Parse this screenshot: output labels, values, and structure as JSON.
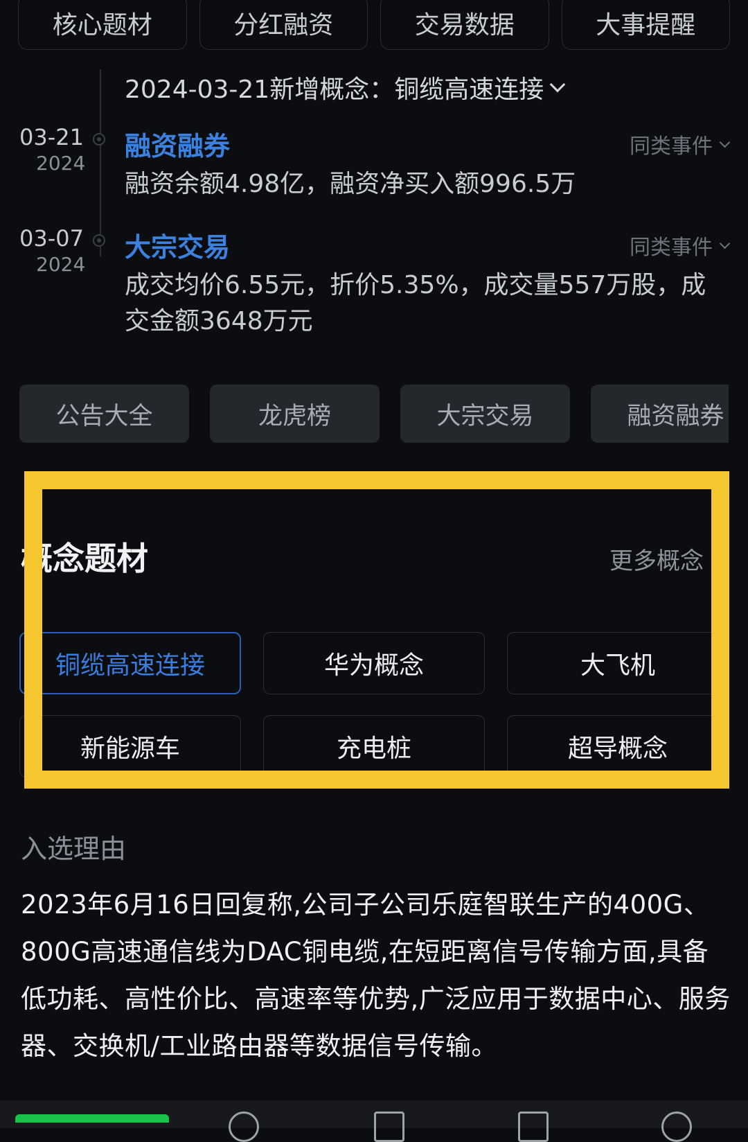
{
  "top_tabs": [
    "核心题材",
    "分红融资",
    "交易数据",
    "大事提醒"
  ],
  "timeline": {
    "new_concept": "2024-03-21新增概念：铜缆高速连接",
    "events": [
      {
        "date": "03-21",
        "year": "2024",
        "title": "融资融券",
        "similar": "同类事件",
        "desc": "融资余额4.98亿，融资净买入额996.5万"
      },
      {
        "date": "03-07",
        "year": "2024",
        "title": "大宗交易",
        "similar": "同类事件",
        "desc": "成交均价6.55元，折价5.35%，成交量557万股，成交金额3648万元"
      }
    ]
  },
  "quick_buttons": [
    "公告大全",
    "龙虎榜",
    "大宗交易",
    "融资融券"
  ],
  "concepts": {
    "title": "概念题材",
    "more": "更多概念",
    "items": [
      "铜缆高速连接",
      "华为概念",
      "大飞机",
      "新能源车",
      "充电桩",
      "超导概念"
    ]
  },
  "reason": {
    "label": "入选理由",
    "text": "2023年6月16日回复称,公司子公司乐庭智联生产的400G、800G高速通信线为DAC铜电缆,在短距离信号传输方面,具备低功耗、高性价比、高速率等优势,广泛应用于数据中心、服务器、交换机/工业路由器等数据信号传输。"
  },
  "colors": {
    "background": "#0b0d10",
    "accent_blue": "#3b82e0",
    "highlight": "#f6c630",
    "price_green": "#19c24a"
  },
  "icons": [
    "history-icon",
    "edit-icon",
    "apps-icon",
    "search-icon"
  ]
}
